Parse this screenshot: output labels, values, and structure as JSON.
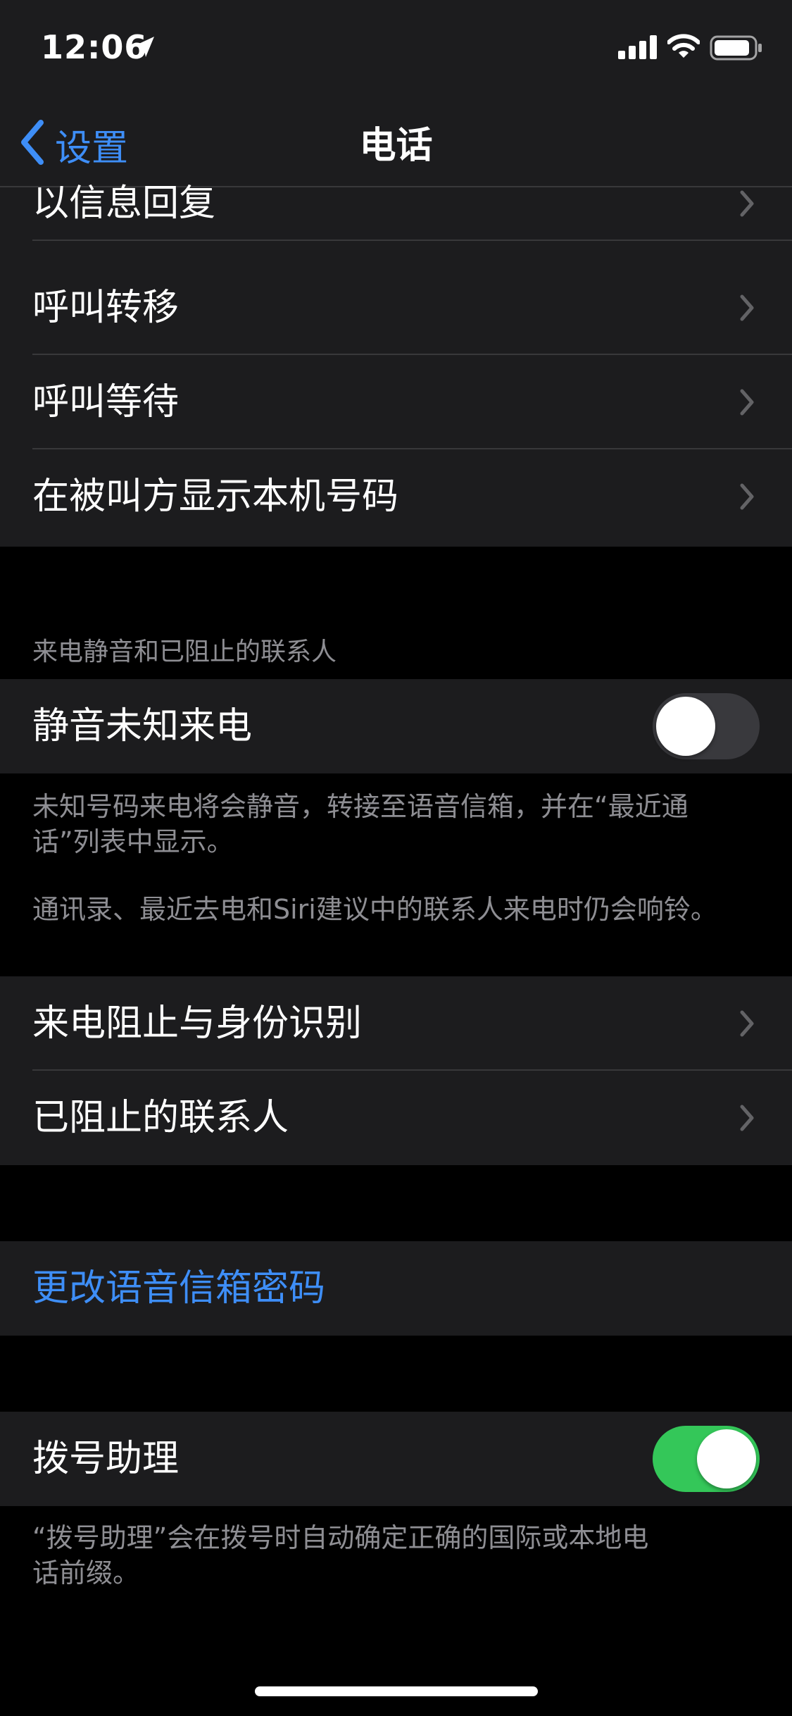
{
  "status_bar": {
    "time": "12:06",
    "battery_level": 0.9
  },
  "nav": {
    "back_label": "设置",
    "title": "电话"
  },
  "call_options": [
    {
      "label": "以信息回复"
    },
    {
      "label": "呼叫转移"
    },
    {
      "label": "呼叫等待"
    },
    {
      "label": "在被叫方显示本机号码"
    }
  ],
  "silence": {
    "header": "来电静音和已阻止的联系人",
    "toggle_label": "静音未知来电",
    "toggle_on": false,
    "footer_1": "未知号码来电将会静音，转接至语音信箱，并在“最近通话”列表中显示。",
    "footer_2": "通讯录、最近去电和Siri建议中的联系人来电时仍会响铃。"
  },
  "blocking": [
    {
      "label": "来电阻止与身份识别"
    },
    {
      "label": "已阻止的联系人"
    }
  ],
  "voicemail": {
    "change_password": "更改语音信箱密码"
  },
  "dial_assist": {
    "label": "拨号助理",
    "toggle_on": true,
    "footer": "“拨号助理”会在拨号时自动确定正确的国际或本地电话前缀。"
  },
  "colors": {
    "accent": "#3e8ef7",
    "toggle_on": "#34c759",
    "group_bg": "#1c1c1e",
    "page_bg": "#000000",
    "secondary_text": "#8e8e93"
  },
  "icons": {
    "location": "location-arrow-icon",
    "signal": "cellular-signal-icon",
    "wifi": "wifi-icon",
    "battery": "battery-icon",
    "back": "chevron-left-icon",
    "disclosure": "chevron-right-icon"
  }
}
